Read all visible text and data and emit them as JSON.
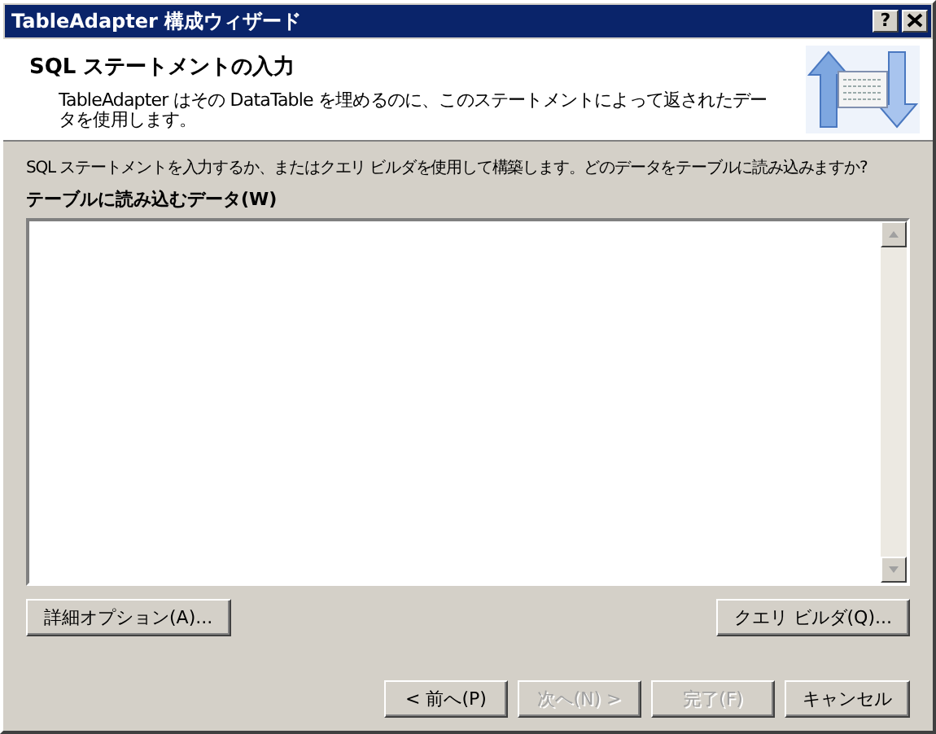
{
  "window": {
    "title": "TableAdapter 構成ウィザード",
    "buttons": [
      {
        "kind": "help",
        "label": "?"
      },
      {
        "kind": "close"
      }
    ]
  },
  "header": {
    "title": "SQL ステートメントの入力",
    "description": "TableAdapter はその DataTable を埋めるのに、このステートメントによって返されたデータを使用します。"
  },
  "instructions": "SQL ステートメントを入力するか、またはクエリ ビルダを使用して構築します。どのデータをテーブルに読み込みますか?",
  "sql_field": {
    "label": "テーブルに読み込むデータ(W)"
  },
  "tool_buttons": [
    {
      "label": "詳細オプション(A)...",
      "disabled": false
    },
    {
      "label": "クエリ ビルダ(Q)...",
      "disabled": false
    }
  ],
  "nav_buttons": [
    {
      "label": "< 前へ(P)",
      "disabled": false
    },
    {
      "label": "次へ(N) >",
      "disabled": true
    },
    {
      "label": "完了(F)",
      "disabled": true
    },
    {
      "label": "キャンセル",
      "disabled": false
    }
  ]
}
